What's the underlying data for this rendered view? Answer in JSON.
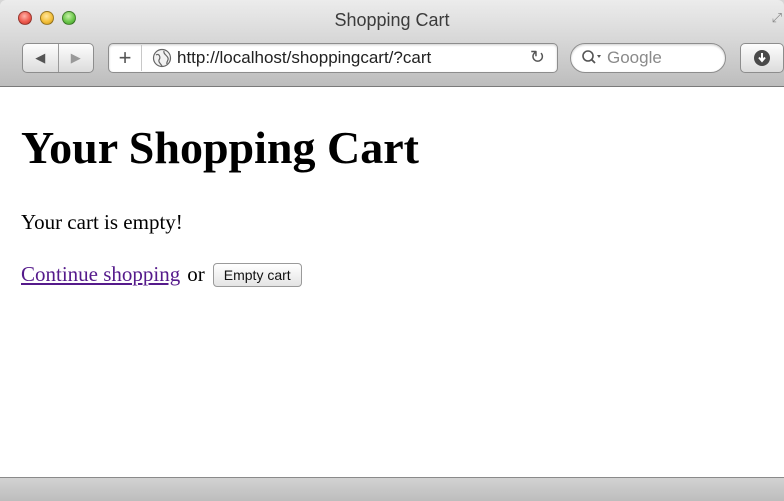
{
  "window": {
    "title": "Shopping Cart",
    "colors": {
      "close": "#ee5b4f",
      "minimize": "#f4c03b",
      "zoom": "#6bc74a"
    }
  },
  "toolbar": {
    "back_icon": "back-arrow-icon",
    "forward_icon": "forward-arrow-icon",
    "add_bookmark": "+",
    "url": "http://localhost/shoppingcart/?cart",
    "reload_icon": "reload-icon",
    "search_placeholder": "Google",
    "download_icon": "download-icon"
  },
  "page": {
    "heading": "Your Shopping Cart",
    "message": "Your cart is empty!",
    "continue_link": "Continue shopping",
    "or_text": "or",
    "empty_button": "Empty cart",
    "link_color": "#551a8b"
  }
}
